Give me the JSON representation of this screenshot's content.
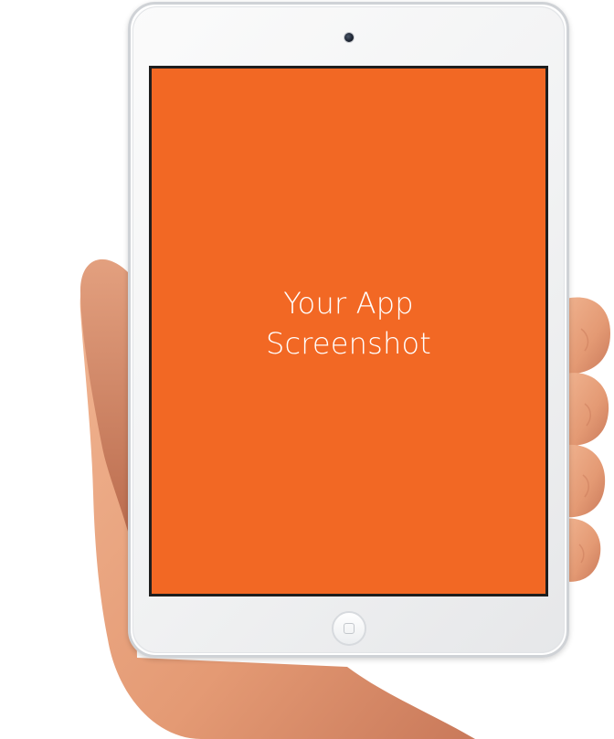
{
  "screen": {
    "line1": "Your App",
    "line2": "Screenshot",
    "background_color": "#f26824",
    "text_color": "#ffffff"
  },
  "device": {
    "type": "tablet",
    "frame_color": "#f4f5f6"
  },
  "hand": {
    "skin_color": "#e8a27c"
  },
  "icons": {
    "camera": "front-camera-icon",
    "home": "home-button-icon"
  }
}
